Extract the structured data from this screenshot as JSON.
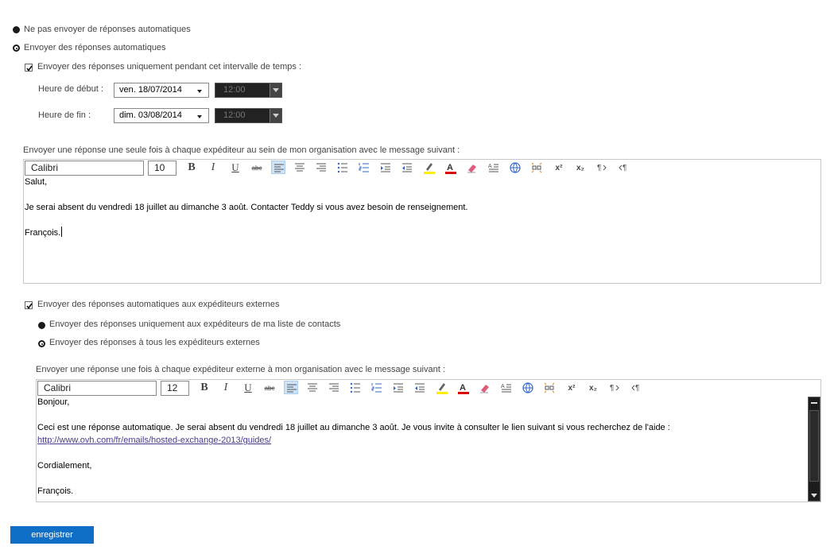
{
  "options": {
    "no_auto_reply": "Ne pas envoyer de réponses automatiques",
    "send_auto_reply": "Envoyer des réponses automatiques",
    "time_range_checkbox": "Envoyer des réponses uniquement pendant cet intervalle de temps :"
  },
  "schedule": {
    "start_label": "Heure de début :",
    "start_date": "ven. 18/07/2014",
    "start_time": "12:00",
    "end_label": "Heure de fin :",
    "end_date": "dim. 03/08/2014",
    "end_time": "12:00"
  },
  "internal": {
    "heading": "Envoyer une réponse une seule fois à chaque expéditeur au sein de mon organisation avec le message suivant :",
    "font": "Calibri",
    "size": "10",
    "lines": [
      "Salut,",
      "",
      "Je serai absent du vendredi 18 juillet au dimanche 3 août. Contacter Teddy si vous avez besoin de renseignement.",
      "",
      "François."
    ]
  },
  "external": {
    "checkbox": "Envoyer des réponses automatiques aux expéditeurs externes",
    "contacts_only": "Envoyer des réponses uniquement aux expéditeurs de ma liste de contacts",
    "all_external": "Envoyer des réponses à tous les expéditeurs externes",
    "heading": "Envoyer une réponse une fois à chaque expéditeur externe à mon organisation avec le message suivant :",
    "font": "Calibri",
    "size": "12",
    "greeting": "Bonjour,",
    "body": "Ceci est une réponse automatique. Je serai absent du vendredi 18 juillet au dimanche 3 août. Je vous invite à consulter le lien suivant si vous recherchez de l'aide :",
    "link": "http://www.ovh.com/fr/emails/hosted-exchange-2013/guides/",
    "closing": "Cordialement,",
    "signature": "François."
  },
  "toolbar": {
    "bold": "B",
    "italic": "I",
    "underline": "U",
    "strike": "abc",
    "superscript": "x²",
    "subscript": "x₂"
  },
  "footer": {
    "save_label": "enregistrer"
  },
  "colors": {
    "accent": "#0f6fc6",
    "highlight": "#ffee00",
    "font_color": "#e00000"
  }
}
